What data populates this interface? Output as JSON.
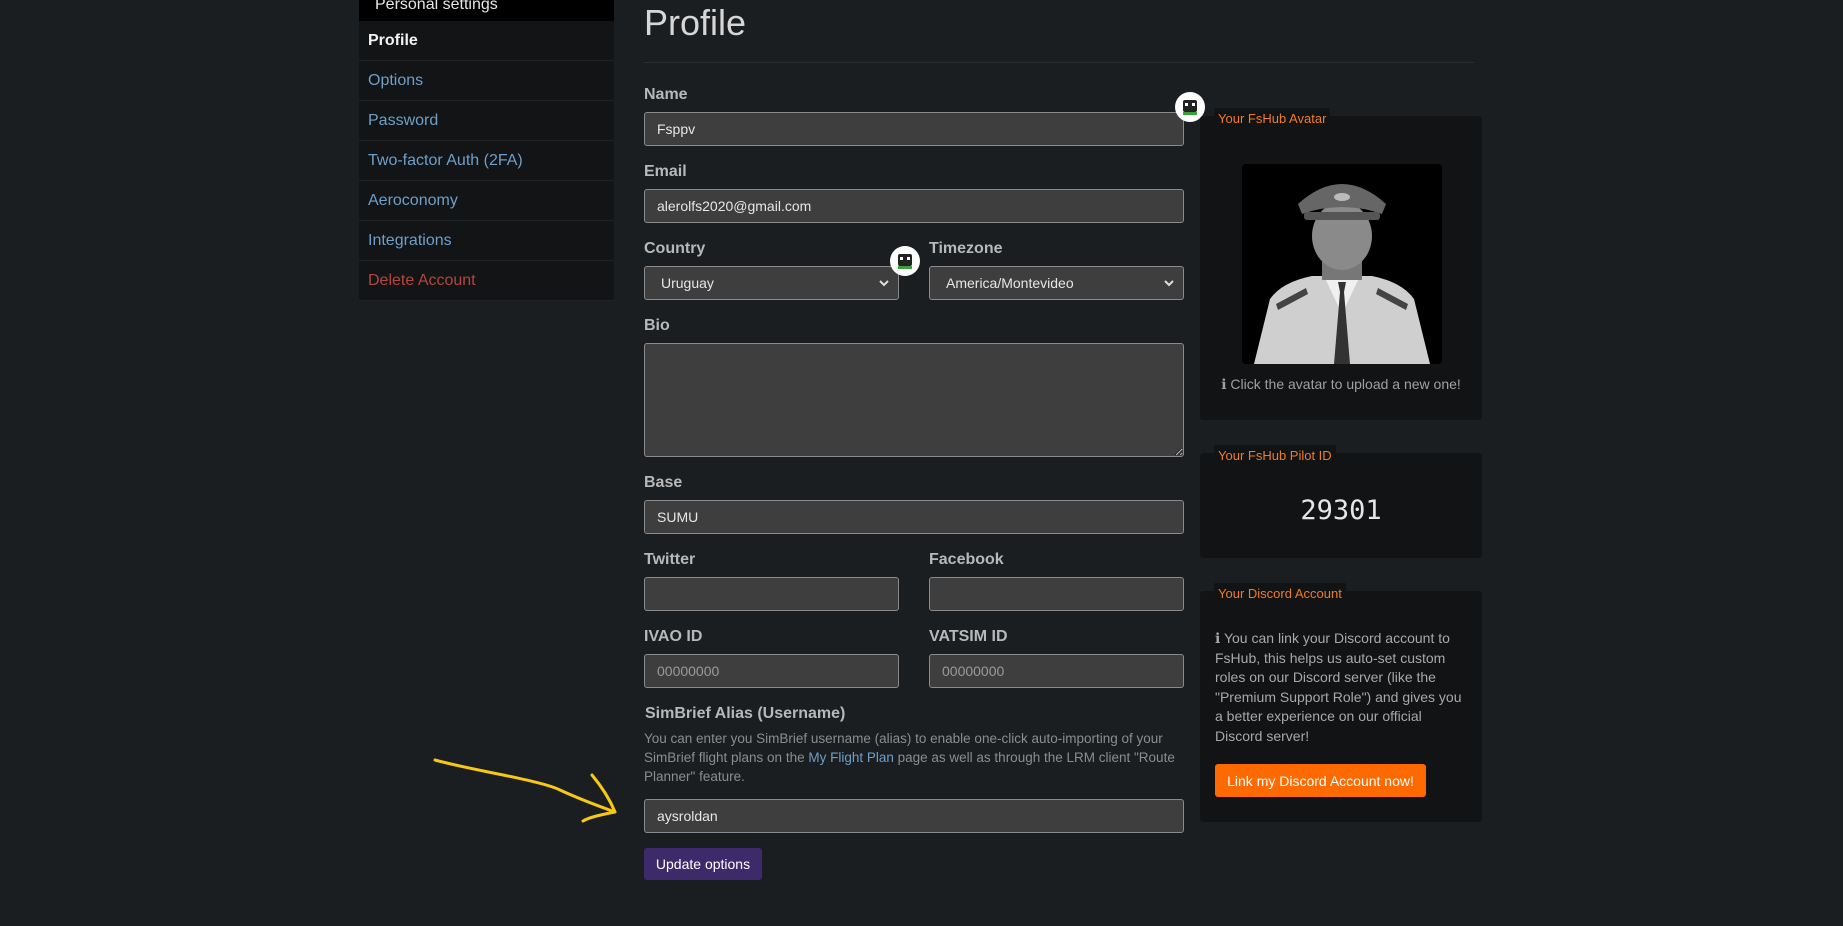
{
  "sidebar": {
    "header": "Personal settings",
    "items": [
      {
        "label": "Profile",
        "state": "active"
      },
      {
        "label": "Options",
        "state": ""
      },
      {
        "label": "Password",
        "state": ""
      },
      {
        "label": "Two-factor Auth (2FA)",
        "state": ""
      },
      {
        "label": "Aeroconomy",
        "state": ""
      },
      {
        "label": "Integrations",
        "state": ""
      },
      {
        "label": "Delete Account",
        "state": "danger"
      }
    ]
  },
  "page": {
    "title": "Profile"
  },
  "form": {
    "name": {
      "label": "Name",
      "value": "Fsppv"
    },
    "email": {
      "label": "Email",
      "value": "alerolfs2020@gmail.com"
    },
    "country": {
      "label": "Country",
      "value": "Uruguay"
    },
    "timezone": {
      "label": "Timezone",
      "value": "America/Montevideo"
    },
    "bio": {
      "label": "Bio",
      "value": ""
    },
    "base": {
      "label": "Base",
      "value": "SUMU"
    },
    "twitter": {
      "label": "Twitter",
      "value": ""
    },
    "facebook": {
      "label": "Facebook",
      "value": ""
    },
    "ivao": {
      "label": "IVAO ID",
      "placeholder": "00000000"
    },
    "vatsim": {
      "label": "VATSIM ID",
      "placeholder": "00000000"
    },
    "simbrief": {
      "label": "SimBrief Alias (Username)",
      "help_before": "You can enter you SimBrief username (alias) to enable one-click auto-importing of your SimBrief flight plans on the ",
      "help_link": "My Flight Plan",
      "help_after": " page as well as through the LRM client \"Route Planner\" feature.",
      "value": "aysroldan"
    },
    "submit_label": "Update options"
  },
  "avatar_panel": {
    "title": "Your FsHub Avatar",
    "note": "Click the avatar to upload a new one!"
  },
  "pilot_panel": {
    "title": "Your FsHub Pilot ID",
    "id": "29301"
  },
  "discord_panel": {
    "title": "Your Discord Account",
    "text": "You can link your Discord account to FsHub, this helps us auto-set custom roles on our Discord server (like the \"Premium Support Role\") and gives you a better experience on our official Discord server!",
    "button_label": "Link my Discord Account now!"
  },
  "colors": {
    "accent": "#f07c22",
    "link": "#6e9fc8",
    "danger": "#b5453f",
    "primary_button": "#3c2a6b",
    "discord_button": "#ff6a00",
    "annotation_arrow": "#f7c815"
  },
  "icons": {
    "bot": "robot-icon",
    "info": "info-icon",
    "chevron": "chevron-down-icon"
  }
}
